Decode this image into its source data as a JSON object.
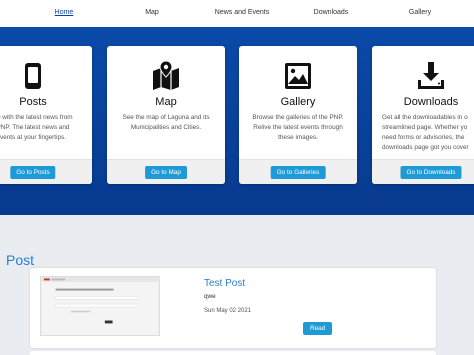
{
  "nav": {
    "items": [
      {
        "label": "Home",
        "active": true
      },
      {
        "label": "Map",
        "active": false
      },
      {
        "label": "News and Events",
        "active": false
      },
      {
        "label": "Downloads",
        "active": false
      },
      {
        "label": "Gallery",
        "active": false
      }
    ]
  },
  "cards": [
    {
      "icon": "phone-icon",
      "title": "Posts",
      "desc": [
        "up with the latest news from",
        "PNP. The latest news and",
        "vents at your fingertips."
      ],
      "button": "Go to Posts"
    },
    {
      "icon": "map-icon",
      "title": "Map",
      "desc": [
        "See the map of Laguna and its",
        "Municipalities and Cities."
      ],
      "button": "Go to Map"
    },
    {
      "icon": "gallery-icon",
      "title": "Gallery",
      "desc": [
        "Browse the galleries of the PNP.",
        "Relive the latest events through",
        "these images."
      ],
      "button": "Go to Galleries"
    },
    {
      "icon": "download-icon",
      "title": "Downloads",
      "desc": [
        "Get all the downloadables in o",
        "streamlined page. Whether yo",
        "need forms or advisories, the",
        "downloads page got you cover"
      ],
      "button": "Go to Downloads"
    }
  ],
  "section": {
    "title": "Post"
  },
  "post": {
    "title": "Test Post",
    "body": "qwe",
    "date": "Sun May 02 2021",
    "button": "Read"
  },
  "colors": {
    "band": "#0a4aa8",
    "accent": "#1e9bd7",
    "link": "#2a7ed3"
  }
}
